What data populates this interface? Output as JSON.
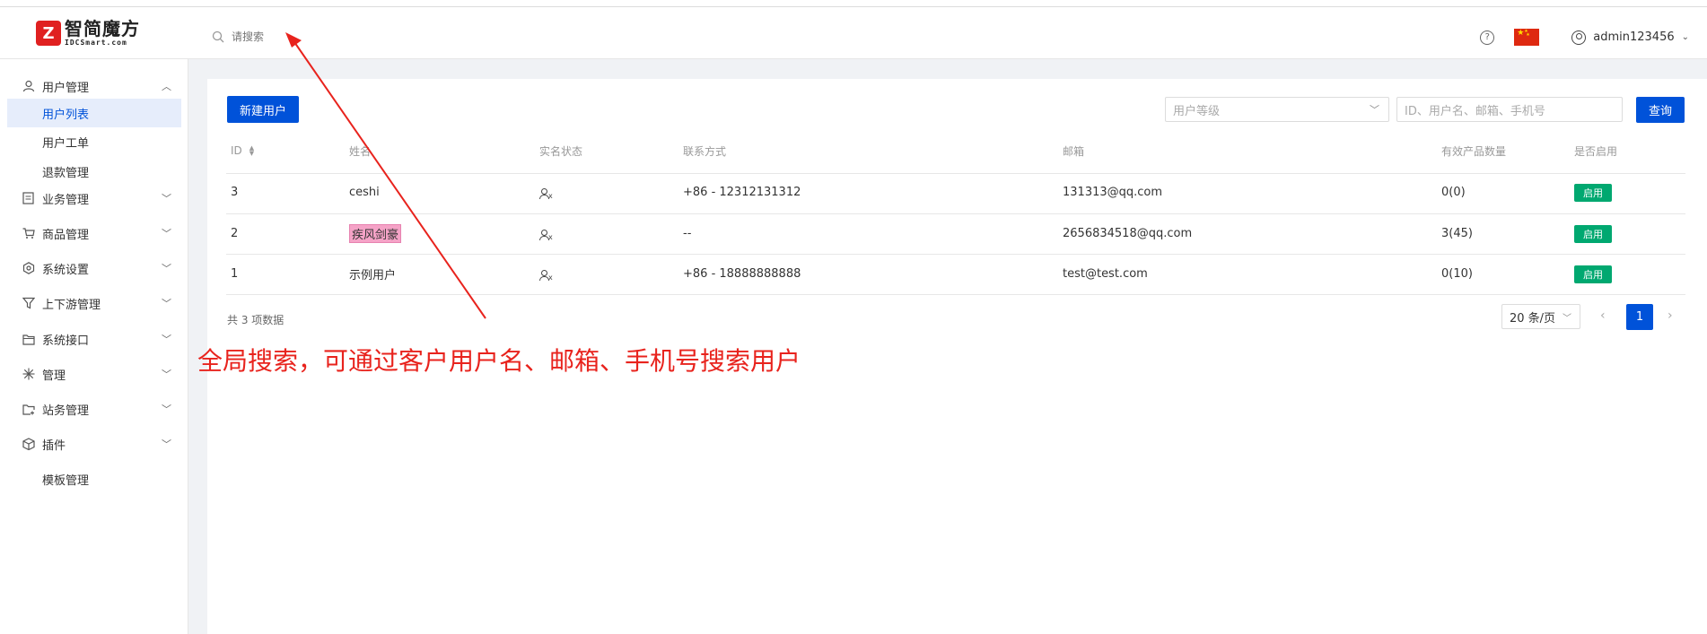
{
  "header": {
    "logo_mark": "Z",
    "logo_cn": "智简魔方",
    "logo_en": "IDCSmart.com",
    "search_placeholder": "请搜索",
    "user_name": "admin123456"
  },
  "sidebar": {
    "groups": [
      {
        "label": "用户管理",
        "icon": "user-icon",
        "expanded": true
      },
      {
        "label": "业务管理",
        "icon": "document-icon"
      },
      {
        "label": "商品管理",
        "icon": "cart-icon"
      },
      {
        "label": "系统设置",
        "icon": "settings-icon"
      },
      {
        "label": "上下游管理",
        "icon": "filter-icon"
      },
      {
        "label": "系统接口",
        "icon": "folder-icon"
      },
      {
        "label": "管理",
        "icon": "asterisk-icon"
      },
      {
        "label": "站务管理",
        "icon": "folder-add-icon"
      },
      {
        "label": "插件",
        "icon": "cube-icon"
      }
    ],
    "sub_items": [
      "用户列表",
      "用户工单",
      "退款管理"
    ],
    "active_sub": "用户列表",
    "template_item": "模板管理"
  },
  "toolbar": {
    "new_user": "新建用户",
    "level_placeholder": "用户等级",
    "query_placeholder": "ID、用户名、邮箱、手机号",
    "query_button": "查询"
  },
  "table": {
    "columns": [
      "ID",
      "姓名",
      "实名状态",
      "联系方式",
      "邮箱",
      "有效产品数量",
      "是否启用"
    ],
    "rows": [
      {
        "id": "3",
        "name": "ceshi",
        "contact": "+86 - 12312131312",
        "email": "131313@qq.com",
        "products": "0(0)",
        "status": "启用"
      },
      {
        "id": "2",
        "name": "疾风剑豪",
        "contact": "--",
        "email": "2656834518@qq.com",
        "products": "3(45)",
        "status": "启用"
      },
      {
        "id": "1",
        "name": "示例用户",
        "contact": "+86 - 18888888888",
        "email": "test@test.com",
        "products": "0(10)",
        "status": "启用"
      }
    ]
  },
  "pagination": {
    "total_text": "共 3 项数据",
    "page_size": "20 条/页",
    "current_page": "1"
  },
  "annotation": "全局搜索，可通过客户用户名、邮箱、手机号搜索用户",
  "colors": {
    "primary": "#0052d9",
    "success": "#00a870",
    "annotation": "#e8231d"
  }
}
